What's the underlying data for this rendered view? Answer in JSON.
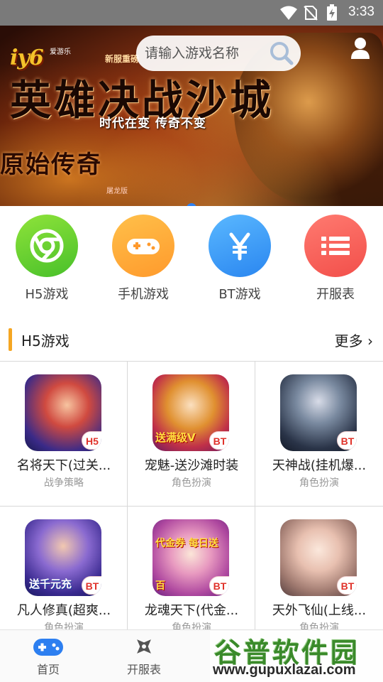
{
  "status_bar": {
    "time": "3:33"
  },
  "banner": {
    "logo": "iy6",
    "logo_sub": "爱游乐",
    "new_server": "新服重磅",
    "headline": "英雄决战沙城",
    "slogan": "时代在变 传奇不变",
    "subhead": "原始传奇",
    "seal": "屠龙版",
    "search": {
      "placeholder": "请输入游戏名称"
    },
    "carousel": {
      "count": 2,
      "active": 2
    }
  },
  "quick_nav": [
    {
      "label": "H5游戏",
      "icon": "chrome-icon"
    },
    {
      "label": "手机游戏",
      "icon": "gamepad-icon"
    },
    {
      "label": "BT游戏",
      "icon": "yen-icon"
    },
    {
      "label": "开服表",
      "icon": "list-icon"
    }
  ],
  "section": {
    "title": "H5游戏",
    "more": "更多 ›"
  },
  "games": [
    {
      "name": "名将天下(过关...",
      "genre": "战争策略",
      "tag": "H5"
    },
    {
      "name": "宠魅-送沙滩时装",
      "genre": "角色扮演",
      "tag": "BT",
      "art_text": "送满级V"
    },
    {
      "name": "天神战(挂机爆...",
      "genre": "角色扮演",
      "tag": "BT"
    },
    {
      "name": "凡人修真(超爽...",
      "genre": "角色扮演",
      "tag": "BT",
      "art_text": "送千元充"
    },
    {
      "name": "龙魂天下(代金...",
      "genre": "角色扮演",
      "tag": "BT",
      "art_text": "代金券 每日送百"
    },
    {
      "name": "天外飞仙(上线...",
      "genre": "角色扮演",
      "tag": "BT"
    }
  ],
  "tab_bar": [
    {
      "label": "首页",
      "icon": "gamepad-icon",
      "active": true
    },
    {
      "label": "开服表",
      "icon": "shuriken-icon",
      "active": false
    }
  ],
  "watermark": {
    "title": "谷普软件园",
    "url": "www.gupuxlazai.com"
  },
  "colors": {
    "accent_blue": "#2d7ff0",
    "section_bar": "#f5a623",
    "tag_red": "#e0322a"
  }
}
